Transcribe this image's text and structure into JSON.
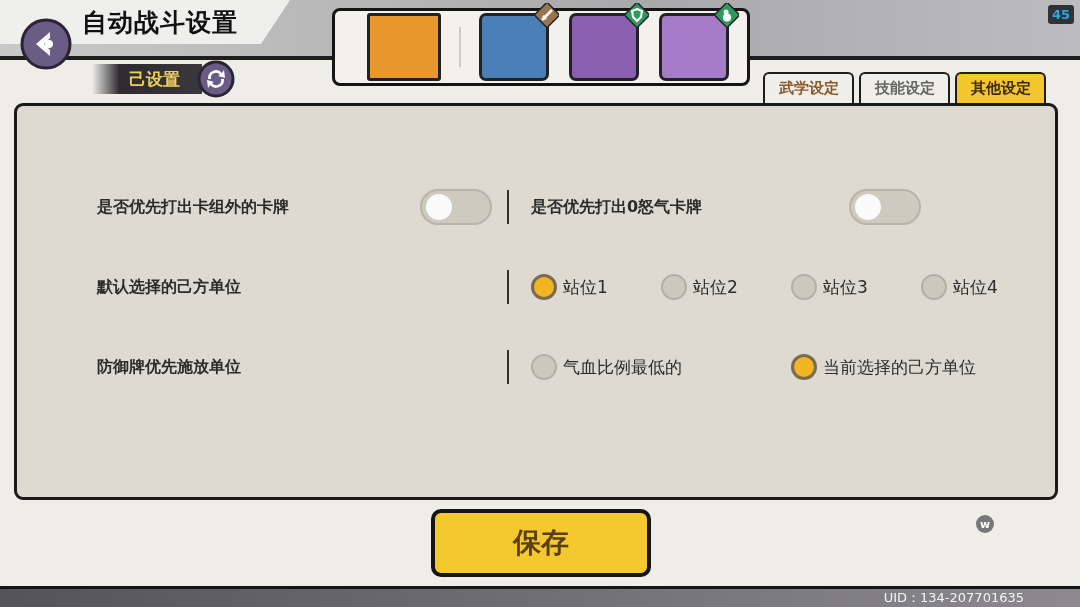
{
  "header": {
    "title": "自动战斗设置",
    "status": "己设置"
  },
  "counter": "45",
  "portraits": [
    {
      "kind": "plain"
    },
    {
      "kind": "sword"
    },
    {
      "kind": "shield"
    },
    {
      "kind": "gourd"
    }
  ],
  "tabs": [
    {
      "label": "武学设定",
      "selected": false
    },
    {
      "label": "技能设定",
      "selected": false
    },
    {
      "label": "其他设定",
      "selected": true
    }
  ],
  "settings": [
    {
      "kind": "toggles",
      "items": [
        {
          "label": "是否优先打出卡组外的卡牌",
          "on": false
        },
        {
          "label": "是否优先打出0怒气卡牌",
          "on": false
        }
      ]
    },
    {
      "kind": "radios",
      "label": "默认选择的己方单位",
      "options": [
        {
          "label": "站位1",
          "selected": true
        },
        {
          "label": "站位2",
          "selected": false
        },
        {
          "label": "站位3",
          "selected": false
        },
        {
          "label": "站位4",
          "selected": false
        }
      ]
    },
    {
      "kind": "radios",
      "label": "防御牌优先施放单位",
      "options": [
        {
          "label": "气血比例最低的",
          "selected": false
        },
        {
          "label": "当前选择的己方单位",
          "selected": true
        }
      ]
    }
  ],
  "save_button": "保存",
  "badge_letter": "w",
  "uid": "UID：134-207701635"
}
